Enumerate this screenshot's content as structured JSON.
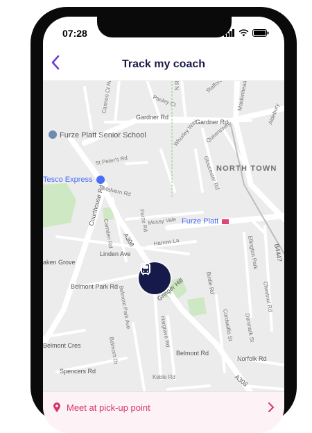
{
  "status_bar": {
    "time": "07:28"
  },
  "header": {
    "title": "Track my coach"
  },
  "map": {
    "places": [
      {
        "key": "school",
        "label": "Furze Platt Senior School"
      },
      {
        "key": "tesco",
        "label": "Tesco Express"
      },
      {
        "key": "station",
        "label": "Furze Platt"
      }
    ],
    "area_label": "NORTH TOWN",
    "streets": {
      "gardner_1": "Gardner Rd",
      "gardner_2": "Gardner Rd",
      "courthouse": "Courthouse Rd",
      "a308_1": "A308",
      "a308_2": "A308",
      "malvern": "Malvern Rd",
      "camden": "Camden Rd",
      "linden": "Linden Ave",
      "belmont_park": "Belmont Park Rd",
      "grove": "aken Grove",
      "harrow": "Harrow La",
      "mossy": "Mossy Vale",
      "furze": "Furze Rd",
      "cannon": "Cannon Ct Rd",
      "stpeters": "St Peter's Rd",
      "whurley": "Whurley Way",
      "queensway": "Queensway",
      "gloucester": "Gloucester Rd",
      "pauley": "Pauley Ct",
      "stafford": "Stafford Cl",
      "maidenhead": "Maidenhead Rd",
      "gringer": "Gringer Hill",
      "belmont_rd": "Belmont Rd",
      "belmont_cres": "Belmont Cres",
      "spencers": "Spencers Rd",
      "norfolk": "Norfolk Rd",
      "keble": "Keble Rd",
      "belmont_dr": "Belmont Dr",
      "belmont_park_ave": "Belmont Park Ave",
      "hargrave": "Hargrave Rd",
      "cordwallis": "Cordwallis St",
      "denmark": "Denmark St",
      "chestnut": "Chestnut Rd",
      "ellington": "Ellington Park",
      "b4447": "B4447",
      "birdie": "Birdie Rd",
      "north_st": "N Rd",
      "cliffords": "Aldebury"
    }
  },
  "bottom_card": {
    "text": "Meet at pick-up point"
  },
  "colors": {
    "accent_purple": "#6b3fd6",
    "bus_marker": "#151a4a",
    "pink": "#d6336c",
    "station_blue": "#4a6cf7",
    "park_green": "#cfe8c4"
  }
}
